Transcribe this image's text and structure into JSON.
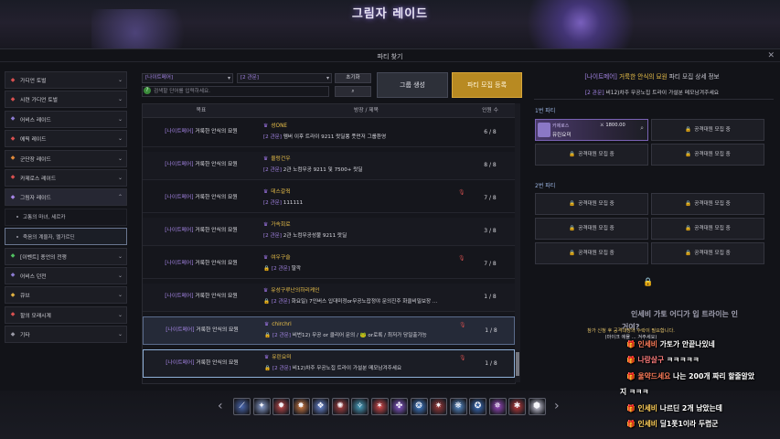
{
  "window": {
    "title": "그림자 레이드",
    "panel_title": "파티 찾기",
    "close_glyph": "✕"
  },
  "sidebar": {
    "items": [
      {
        "label": "가디언 토벌",
        "icon": "red-diamond-icon",
        "color": "#d85050"
      },
      {
        "label": "시련 가디언 토벌",
        "icon": "red-diamond-icon",
        "color": "#d85050"
      },
      {
        "label": "어비스 레이드",
        "icon": "abyss-icon",
        "color": "#8a7ad0"
      },
      {
        "label": "에픽 레이드",
        "icon": "epic-icon",
        "color": "#d85050"
      },
      {
        "label": "군단장 레이드",
        "icon": "legion-icon",
        "color": "#e08a3a"
      },
      {
        "label": "카제로스 레이드",
        "icon": "kazeros-icon",
        "color": "#d85050"
      },
      {
        "label": "그림자 레이드",
        "icon": "shadow-icon",
        "color": "#a585e6",
        "open": true
      }
    ],
    "sub_items": [
      {
        "label": "고통의 마녀, 세르카",
        "selected": false
      },
      {
        "label": "죽음의 계율자, 멜가르딘",
        "selected": true
      }
    ],
    "items2": [
      {
        "label": "[이벤트] 종언의 전쟁",
        "icon": "event-icon",
        "color": "#50c060"
      },
      {
        "label": "어비스 던전",
        "icon": "dungeon-icon",
        "color": "#8a7ad0"
      },
      {
        "label": "큐브",
        "icon": "cube-icon",
        "color": "#e0b040"
      },
      {
        "label": "할의 모래시계",
        "icon": "hourglass-icon",
        "color": "#d85050"
      },
      {
        "label": "기타",
        "icon": "etc-icon",
        "color": "#9a9aa6"
      }
    ],
    "chevron_down": "⌄",
    "chevron_up": "⌃"
  },
  "filters": {
    "difficulty": "[나이트메어]",
    "category": "[2 관문]",
    "reset_label": "초기화",
    "search_placeholder": "검색할 단어를 입력하세요.",
    "group_button": "그룹 생성",
    "recruit_button": "파티 모집 등록"
  },
  "table": {
    "headers": {
      "objective": "목표",
      "title": "방장 / 제목",
      "count": "인원 수"
    },
    "rows": [
      {
        "tag": "[나이트메어]",
        "name": "거룩한 안식의 묘원",
        "host": "성ONE",
        "lvl": "[2 관문]",
        "desc": "멤버 이후 트라이 9211 랏딜뽕 풋먼저 그룹환영",
        "count": "6 / 8",
        "locked": false,
        "mic": false
      },
      {
        "tag": "[나이트메어]",
        "name": "거룩한 안식의 묘원",
        "host": "울렁건우",
        "lvl": "[2 관문]",
        "desc": "2관 노컴무공 9211 및 7500+ 랏딜",
        "count": "8 / 8",
        "locked": false,
        "mic": false
      },
      {
        "tag": "[나이트메어]",
        "name": "거룩한 안식의 묘원",
        "host": "데스갈쥑",
        "lvl": "[2 관문]",
        "desc": "111111",
        "count": "7 / 8",
        "locked": false,
        "mic": true
      },
      {
        "tag": "[나이트메어]",
        "name": "거룩한 안식의 묘원",
        "host": "가속회로",
        "lvl": "[2 관문]",
        "desc": "2관 노컴무공성불 9211 랏딜",
        "count": "3 / 8",
        "locked": false,
        "mic": false
      },
      {
        "tag": "[나이트메어]",
        "name": "거룩한 안식의 묘원",
        "host": "여우구슬",
        "lvl": "[2 관문]",
        "desc": "딸깍",
        "count": "7 / 8",
        "locked": true,
        "mic": true
      },
      {
        "tag": "[나이트메어]",
        "name": "거룩한 안식의 묘원",
        "host": "유성구루난의하리케인",
        "lvl": "[2 관문]",
        "desc": "화요일) 7인버스 입대미정or무공노잡정야 문의진주 화클비밀보장 ...",
        "count": "1 / 8",
        "locked": true,
        "mic": false
      },
      {
        "tag": "[나이트메어]",
        "name": "거룩한 안식의 묘원",
        "host": "chirchri",
        "lvl": "[2 관문]",
        "desc": "비번12) 무공 or 클리어 문의 / 🐸 or로록 / 최저가 당일출가능",
        "count": "1 / 8",
        "locked": true,
        "mic": true
      },
      {
        "tag": "[나이트메어]",
        "name": "거룩한 안식의 묘원",
        "host": "유린요미",
        "lvl": "[2 관문]",
        "desc": "비12)차주 무공노집 트라이 가설분 메모남겨주세요",
        "count": "1 / 8",
        "locked": true,
        "mic": true
      }
    ]
  },
  "detail": {
    "tag": "[나이트메어]",
    "name": "거룩한 안식의 묘원",
    "suffix": "파티 모집 상세 정보",
    "sub_lvl": "[2 관문]",
    "sub_text": "비12)차주 무공노집 트라이 가설분 메모남겨주세요",
    "party1_label": "1번 파티",
    "party2_label": "2번 파티",
    "member": {
      "class": "카제로스",
      "power": "1800.00",
      "name": "유린요미"
    },
    "empty_slot": "공격대원 모집 중"
  },
  "notice": {
    "line1": "참가 신청 후 공격대장의 수락이 필요합니다.",
    "line2": "(마이크 에뮬 ... 겨주세요)"
  },
  "chat": [
    {
      "user": "인세비",
      "msg": "가토가 안끝나있네"
    },
    {
      "user": "나랑살구",
      "msg": "ㅋㅋㅋㅋㅋ"
    },
    {
      "user": "울약드세요",
      "msg": "나는 200개 짜리 할줄알았"
    },
    {
      "user": "",
      "msg": "지 ㅋㅋㅋ"
    },
    {
      "user": "인세비",
      "msg": "나르딘 2개 남았는데"
    },
    {
      "user": "인세비",
      "msg": "딜1폿1이라 두렵군"
    }
  ],
  "faded_chat": "인세비 가토 어디가 입 트라이는 인",
  "faded_chat2": "거여?",
  "skills": [
    "#4a68b0",
    "#8aa0d0",
    "#c04848",
    "#d07a40",
    "#6a8ad8",
    "#b04040",
    "#48a0c0",
    "#d84848",
    "#8a5ad0",
    "#4080d0",
    "#a03838",
    "#5890d0",
    "#3a70c0",
    "#9a48c0",
    "#c03a3a",
    "#d8d8e8"
  ]
}
